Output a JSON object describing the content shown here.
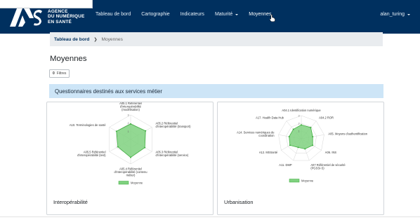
{
  "brand": {
    "logo_lines": [
      "AGENCE",
      "DU NUMÉRIQUE",
      "EN SANTÉ"
    ]
  },
  "nav": {
    "items": [
      "Tableau de bord",
      "Cartographie",
      "Indicateurs",
      "Maturité",
      "Moyennes"
    ],
    "user": "alan_turing"
  },
  "breadcrumb": {
    "home": "Tableau de bord",
    "current": "Moyennes"
  },
  "page_title": "Moyennes",
  "filters": {
    "count": "0",
    "label": "Filtres"
  },
  "section_title": "Questionnaires destinés aux services métier",
  "colors": {
    "navbar": "#00305f",
    "series_fill": "#7fd17f",
    "series_stroke": "#3fae3f",
    "banner": "#cde5f7"
  },
  "chart_data": [
    {
      "type": "radar",
      "title": "Interopérabilité",
      "axes": [
        "A05.1 Référentiel d'interopérabilité (modélisation)",
        "A05.2 Référentiel d'interopérabilité (transport)",
        "A05.3 Référentiel d'interopérabilité (service)",
        "A05.4 Référentiel d'interopérabilité (contenu métier)",
        "A05.5 Référentiel d'interopérabilité (test)",
        "A10. Terminologies de santé"
      ],
      "ticks": [
        "1",
        "2",
        "3"
      ],
      "rmax": 3,
      "series": [
        {
          "name": "Moyenne",
          "values": [
            1.9,
            2.1,
            2.0,
            2.2,
            1.8,
            2.0
          ]
        }
      ],
      "legend": "bottom"
    },
    {
      "type": "radar",
      "title": "Urbanisation",
      "axes": [
        "A04.1 Identification numérique",
        "A04.2 ROR",
        "A05. Moyens d'authentification",
        "A06. INS",
        "A07 Référentiel de sécurité (PGSSI-S)",
        "A11. DMP",
        "A12. MSSanté",
        "A14. Services numériques de coordination",
        "A17. Health Data Hub"
      ],
      "ticks": [
        "1",
        "2",
        "3"
      ],
      "rmax": 3,
      "series": [
        {
          "name": "Moyenne",
          "values": [
            1.8,
            1.9,
            1.5,
            1.7,
            1.4,
            1.2,
            1.7,
            1.6,
            1.6
          ]
        }
      ],
      "legend": "bottom"
    }
  ]
}
